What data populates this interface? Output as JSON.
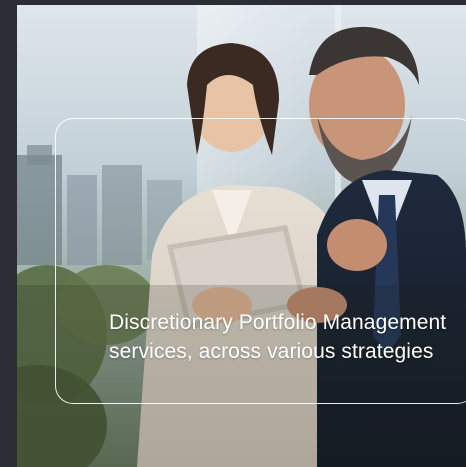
{
  "hero": {
    "caption": "Discretionary Portfolio Management services, across various strategies",
    "image_icon": "photo-image"
  },
  "colors": {
    "background": "#2b2e34",
    "caption_text": "#ffffff",
    "card_border": "#ffffff"
  }
}
